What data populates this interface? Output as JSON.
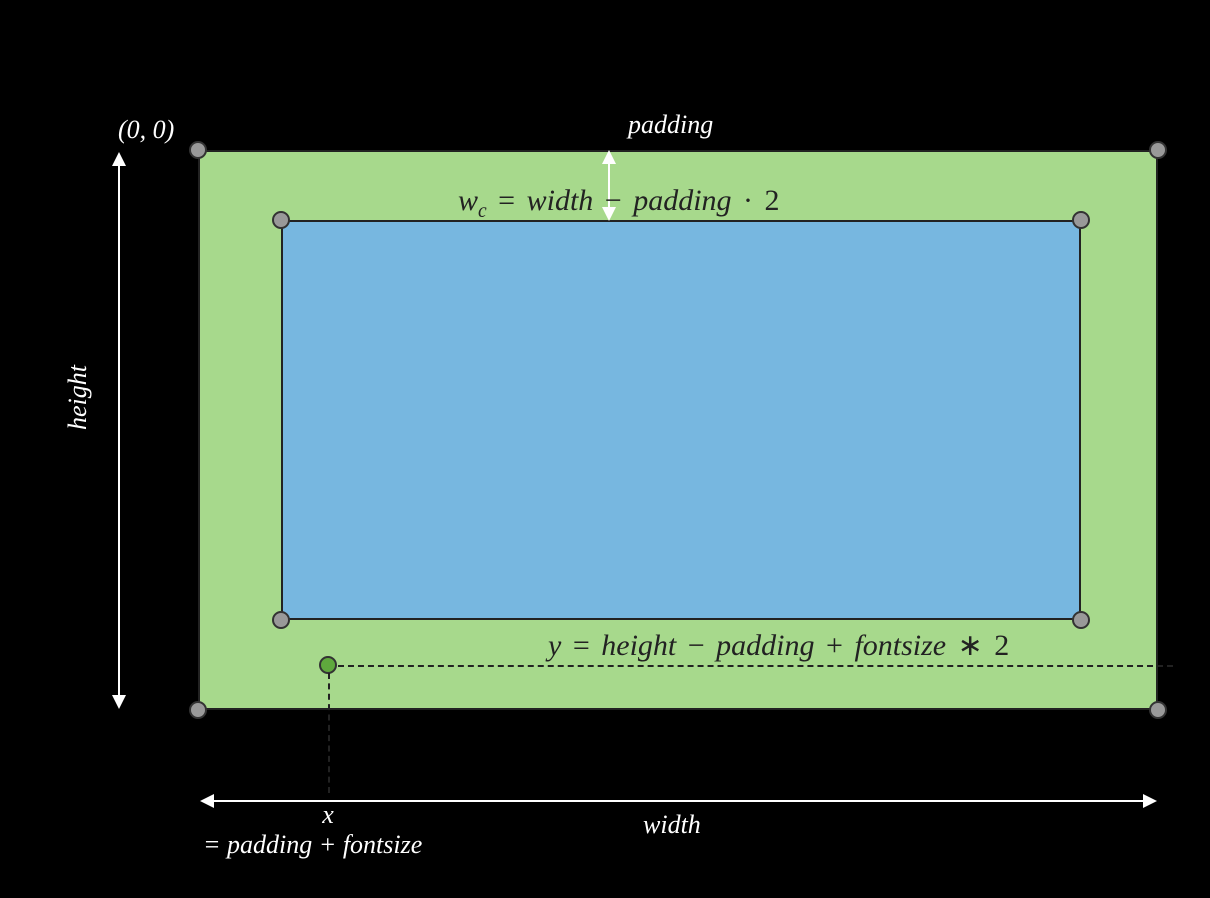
{
  "labels": {
    "origin": "(0, 0)",
    "height": "height",
    "width": "width",
    "padding": "padding",
    "x": "x",
    "x_value": "= padding + fontsize"
  },
  "formulas": {
    "wc_lhs_var": "w",
    "wc_lhs_sub": "c",
    "wc_eq": "=",
    "wc_rhs_a": "width",
    "wc_minus": "−",
    "wc_rhs_b": "padding",
    "wc_dot": "·",
    "wc_rhs_c": "2",
    "y_lhs": "y",
    "y_eq": "=",
    "y_a": "height",
    "y_minus": "−",
    "y_b": "padding",
    "y_plus": "+",
    "y_c": "fontsize",
    "y_star": "∗",
    "y_d": "2"
  }
}
